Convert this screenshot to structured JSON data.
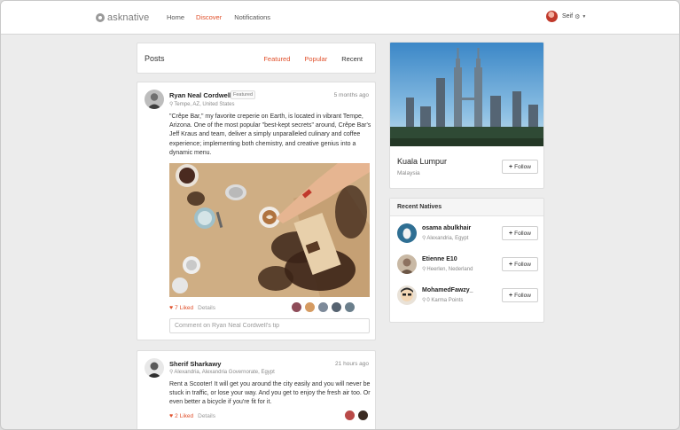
{
  "brand": {
    "name": "asknative"
  },
  "nav": {
    "home": "Home",
    "discover": "Discover",
    "notifications": "Notifications"
  },
  "user": {
    "name": "Seif",
    "gear": "⚙",
    "caret": "▼"
  },
  "posts_panel": {
    "title": "Posts",
    "tabs": [
      "Featured",
      "Popular",
      "Recent"
    ],
    "active_tab": "Recent"
  },
  "posts": [
    {
      "author": "Ryan Neal Cordwell",
      "badge": "Featured",
      "location": "Tempe, AZ, United States",
      "time": "5 months ago",
      "body": "\"Crêpe Bar,\" my favorite creperie on Earth, is located in vibrant Tempe, Arizona. One of the most popular \"best-kept secrets\" around, Crêpe Bar's Jeff Kraus and team, deliver a simply unparalleled culinary and coffee experience; implementing both chemistry, and creative genius into a dynamic menu.",
      "likes": "7 Liked",
      "details": "Details",
      "comment_placeholder": "Comment on Ryan Neal Cordwell's tip"
    },
    {
      "author": "Sherif Sharkawy",
      "location": "Alexandria, Alexandria Governorate, Egypt",
      "time": "21 hours ago",
      "body": "Rent a Scooter! It will get you around the city easily and you will never be stuck in traffic, or lose your way. And you get to enjoy the fresh air too. Or even better a bicycle if you're fit for it.",
      "likes": "2 Liked",
      "details": "Details"
    }
  ],
  "city": {
    "name": "Kuala Lumpur",
    "country": "Malaysia",
    "follow_label": "Follow"
  },
  "recent_natives": {
    "title": "Recent Natives",
    "items": [
      {
        "name": "osama abulkhair",
        "sub": "Alexandria, Egypt",
        "follow_label": "Follow"
      },
      {
        "name": "Etienne E10",
        "sub": "Heerlen, Nederland",
        "follow_label": "Follow"
      },
      {
        "name": "MohamedFawzy_",
        "sub": "0 Karma Points",
        "follow_label": "Follow"
      }
    ]
  },
  "icons": {
    "location": "map-pin-icon",
    "like": "heart-icon",
    "follow": "plus-icon",
    "settings": "gear-icon",
    "dropdown": "caret-down-icon"
  },
  "colors": {
    "accent": "#e0502b",
    "background": "#ececec"
  }
}
